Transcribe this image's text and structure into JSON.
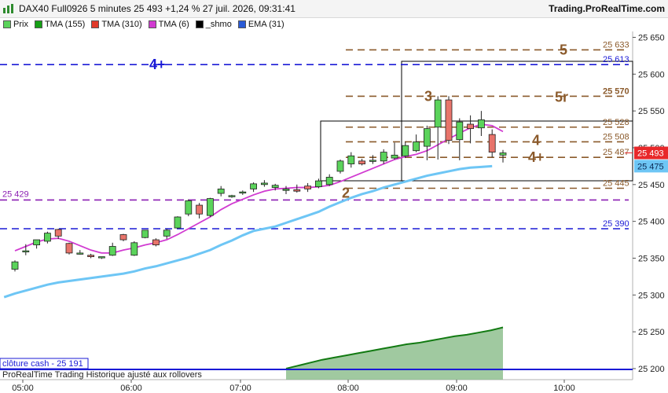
{
  "header": {
    "title": "DAX40 Full0926 5 minutes 25 493 +1,24 % 27 juil. 2026, 09:31:41",
    "brand": "Trading.ProRealTime.com"
  },
  "legend": [
    {
      "label": "Prix",
      "color": "#5bd35b"
    },
    {
      "label": "TMA (155)",
      "color": "#16a016"
    },
    {
      "label": "TMA (310)",
      "color": "#e03a2a"
    },
    {
      "label": "TMA (6)",
      "color": "#d13bd1"
    },
    {
      "label": "_shmo",
      "color": "#000000"
    },
    {
      "label": "EMA (31)",
      "color": "#2a5bd6"
    }
  ],
  "footer": {
    "cash_label": "clôture cash -  25 191",
    "note": "ProRealTime Trading  Historique ajusté aux rollovers"
  },
  "chart_data": {
    "type": "candlestick",
    "ylim": [
      25185,
      25658
    ],
    "x_ticks": [
      "05:00",
      "06:00",
      "07:00",
      "08:00",
      "09:00",
      "10:00"
    ],
    "y_ticks": [
      25200,
      25250,
      25300,
      25350,
      25400,
      25450,
      25500,
      25550,
      25600,
      25650
    ],
    "y_tick_labels": [
      "25 200",
      "25 250",
      "25 300",
      "25 350",
      "25 400",
      "25 450",
      "25 500",
      "25 550",
      "25 600",
      "25 650"
    ],
    "current_price": {
      "value": 25493,
      "label": "25 493",
      "color": "#e8282a"
    },
    "ema_last": {
      "value": 25475,
      "label": "25 475",
      "color": "#6ec6f5"
    },
    "levels": [
      {
        "value": 25633,
        "label": "25 633",
        "tag": "5",
        "color": "#8b5a2b",
        "style": "dash"
      },
      {
        "value": 25613,
        "label": "25 613",
        "tag": "4+",
        "color": "#1a1ad6",
        "style": "dash-blue"
      },
      {
        "value": 25570,
        "label": "25 570",
        "tag": "5r",
        "color": "#8b5a2b",
        "style": "dash"
      },
      {
        "value": 25570,
        "label": "",
        "tag": "3",
        "color": "#8b5a2b",
        "style": "tag-only"
      },
      {
        "value": 25528,
        "label": "25 528",
        "tag": "",
        "color": "#8b5a2b",
        "style": "dash"
      },
      {
        "value": 25508,
        "label": "25 508",
        "tag": "4",
        "color": "#8b5a2b",
        "style": "dash"
      },
      {
        "value": 25487,
        "label": "25 487",
        "tag": "4+",
        "color": "#8b5a2b",
        "style": "dash"
      },
      {
        "value": 25445,
        "label": "25 445",
        "tag": "2",
        "color": "#8b5a2b",
        "style": "dash"
      },
      {
        "value": 25429,
        "label": "25 429",
        "tag": "",
        "color": "#8b1fb3",
        "style": "dash-purple"
      },
      {
        "value": 25390,
        "label": "25 390",
        "tag": "",
        "color": "#1a1ad6",
        "style": "dash-blue"
      }
    ],
    "candles": [
      {
        "o": 25335,
        "h": 25347,
        "l": 25332,
        "c": 25345
      },
      {
        "o": 25359,
        "h": 25369,
        "l": 25354,
        "c": 25360
      },
      {
        "o": 25368,
        "h": 25375,
        "l": 25363,
        "c": 25375
      },
      {
        "o": 25373,
        "h": 25386,
        "l": 25370,
        "c": 25384
      },
      {
        "o": 25389,
        "h": 25390,
        "l": 25376,
        "c": 25380
      },
      {
        "o": 25370,
        "h": 25371,
        "l": 25355,
        "c": 25357
      },
      {
        "o": 25357,
        "h": 25361,
        "l": 25355,
        "c": 25357
      },
      {
        "o": 25354,
        "h": 25356,
        "l": 25350,
        "c": 25352
      },
      {
        "o": 25352,
        "h": 25352,
        "l": 25349,
        "c": 25352
      },
      {
        "o": 25354,
        "h": 25371,
        "l": 25353,
        "c": 25366
      },
      {
        "o": 25382,
        "h": 25383,
        "l": 25373,
        "c": 25375
      },
      {
        "o": 25354,
        "h": 25373,
        "l": 25353,
        "c": 25371
      },
      {
        "o": 25378,
        "h": 25388,
        "l": 25377,
        "c": 25388
      },
      {
        "o": 25375,
        "h": 25377,
        "l": 25366,
        "c": 25368
      },
      {
        "o": 25380,
        "h": 25390,
        "l": 25376,
        "c": 25388
      },
      {
        "o": 25391,
        "h": 25407,
        "l": 25390,
        "c": 25406
      },
      {
        "o": 25410,
        "h": 25430,
        "l": 25407,
        "c": 25428
      },
      {
        "o": 25422,
        "h": 25425,
        "l": 25404,
        "c": 25410
      },
      {
        "o": 25408,
        "h": 25432,
        "l": 25406,
        "c": 25431
      },
      {
        "o": 25438,
        "h": 25448,
        "l": 25434,
        "c": 25444
      },
      {
        "o": 25434,
        "h": 25436,
        "l": 25432,
        "c": 25435
      },
      {
        "o": 25439,
        "h": 25442,
        "l": 25436,
        "c": 25440
      },
      {
        "o": 25444,
        "h": 25453,
        "l": 25440,
        "c": 25451
      },
      {
        "o": 25450,
        "h": 25456,
        "l": 25447,
        "c": 25452
      },
      {
        "o": 25446,
        "h": 25451,
        "l": 25442,
        "c": 25449
      },
      {
        "o": 25442,
        "h": 25448,
        "l": 25437,
        "c": 25444
      },
      {
        "o": 25443,
        "h": 25450,
        "l": 25439,
        "c": 25441
      },
      {
        "o": 25448,
        "h": 25452,
        "l": 25440,
        "c": 25444
      },
      {
        "o": 25447,
        "h": 25458,
        "l": 25445,
        "c": 25455
      },
      {
        "o": 25450,
        "h": 25464,
        "l": 25448,
        "c": 25460
      },
      {
        "o": 25468,
        "h": 25484,
        "l": 25465,
        "c": 25482
      },
      {
        "o": 25478,
        "h": 25494,
        "l": 25473,
        "c": 25489
      },
      {
        "o": 25482,
        "h": 25485,
        "l": 25476,
        "c": 25478
      },
      {
        "o": 25482,
        "h": 25490,
        "l": 25478,
        "c": 25483
      },
      {
        "o": 25482,
        "h": 25498,
        "l": 25478,
        "c": 25494
      },
      {
        "o": 25486,
        "h": 25507,
        "l": 25484,
        "c": 25490
      },
      {
        "o": 25489,
        "h": 25508,
        "l": 25486,
        "c": 25503
      },
      {
        "o": 25496,
        "h": 25518,
        "l": 25494,
        "c": 25508
      },
      {
        "o": 25502,
        "h": 25530,
        "l": 25483,
        "c": 25526
      },
      {
        "o": 25528,
        "h": 25570,
        "l": 25484,
        "c": 25565
      },
      {
        "o": 25565,
        "h": 25570,
        "l": 25505,
        "c": 25510
      },
      {
        "o": 25511,
        "h": 25540,
        "l": 25483,
        "c": 25535
      },
      {
        "o": 25532,
        "h": 25544,
        "l": 25506,
        "c": 25526
      },
      {
        "o": 25527,
        "h": 25550,
        "l": 25516,
        "c": 25538
      },
      {
        "o": 25518,
        "h": 25525,
        "l": 25487,
        "c": 25494
      },
      {
        "o": 25490,
        "h": 25497,
        "l": 25480,
        "c": 25493
      }
    ],
    "tma6": [
      25360,
      25366,
      25372,
      25376,
      25377,
      25373,
      25367,
      25361,
      25357,
      25357,
      25361,
      25364,
      25368,
      25371,
      25375,
      25382,
      25390,
      25398,
      25406,
      25416,
      25424,
      25430,
      25436,
      25441,
      25444,
      25445,
      25446,
      25446,
      25447,
      25449,
      25454,
      25460,
      25466,
      25472,
      25478,
      25484,
      25488,
      25491,
      25496,
      25504,
      25512,
      25520,
      25527,
      25532,
      25530,
      25522
    ],
    "ema31": [
      25297,
      25302,
      25306,
      25310,
      25314,
      25317,
      25319,
      25321,
      25323,
      25325,
      25327,
      25329,
      25332,
      25336,
      25339,
      25343,
      25347,
      25351,
      25356,
      25361,
      25368,
      25374,
      25381,
      25387,
      25390,
      25393,
      25398,
      25403,
      25408,
      25413,
      25420,
      25426,
      25432,
      25437,
      25441,
      25446,
      25450,
      25454,
      25458,
      25462,
      25465,
      25468,
      25471,
      25473,
      25474,
      25475
    ],
    "shmo": [
      25200,
      25204,
      25208,
      25212,
      25215,
      25218,
      25221,
      25224,
      25227,
      25230,
      25233,
      25235,
      25238,
      25241,
      25244,
      25246,
      25249,
      25252,
      25256
    ]
  }
}
